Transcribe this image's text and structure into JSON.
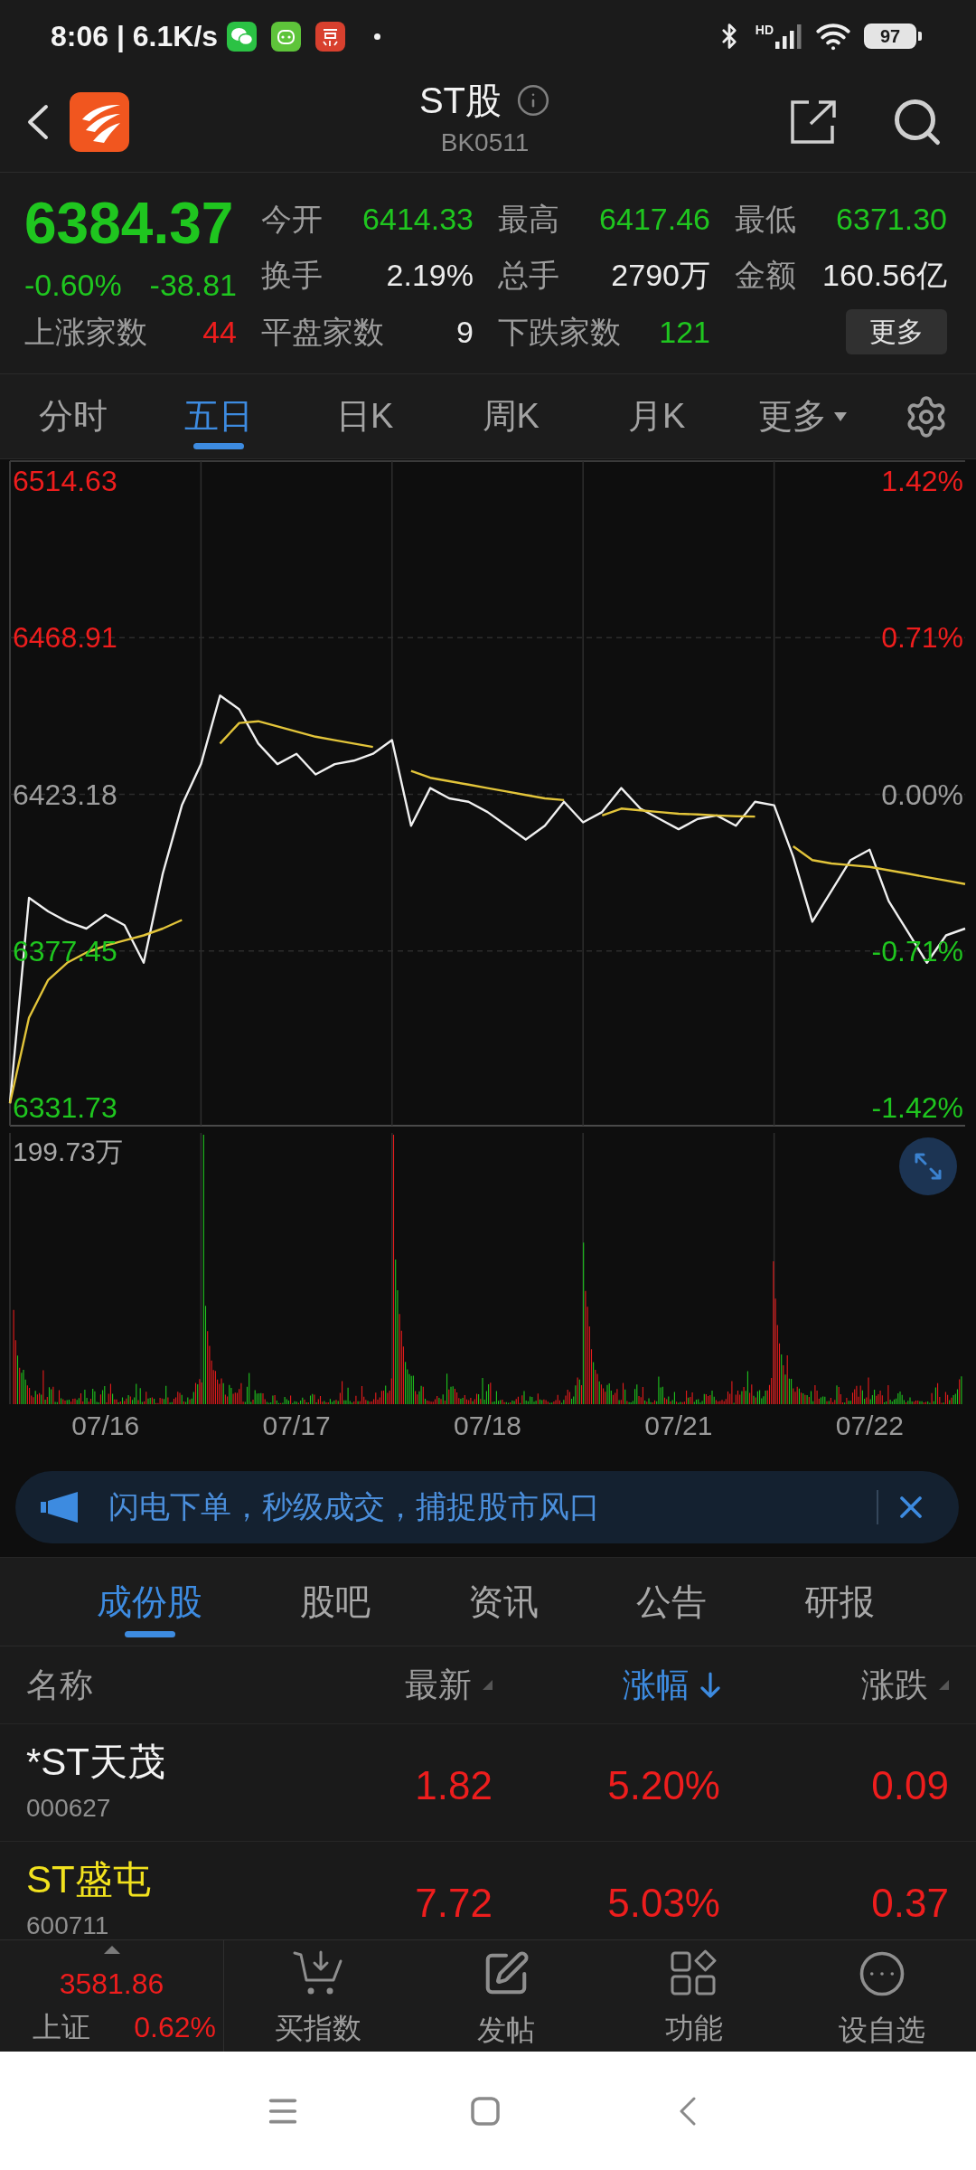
{
  "status_bar": {
    "text": "8:06 | 6.1K/s",
    "network": "HD",
    "battery": "97"
  },
  "header": {
    "title": "ST股",
    "code": "BK0511"
  },
  "quote": {
    "color": "#1fc61f",
    "price": "6384.37",
    "change_pct": "-0.60%",
    "change": "-38.81",
    "stats": [
      {
        "label": "今开",
        "value": "6414.33",
        "color": "#1fc61f"
      },
      {
        "label": "最高",
        "value": "6417.46",
        "color": "#1fc61f"
      },
      {
        "label": "最低",
        "value": "6371.30",
        "color": "#1fc61f"
      },
      {
        "label": "换手",
        "value": "2.19%",
        "color": "#ececec"
      },
      {
        "label": "总手",
        "value": "2790万",
        "color": "#ececec"
      },
      {
        "label": "金额",
        "value": "160.56亿",
        "color": "#ececec"
      }
    ],
    "counts": [
      {
        "label": "上涨家数",
        "value": "44",
        "color": "#ee1d1d"
      },
      {
        "label": "平盘家数",
        "value": "9",
        "color": "#ececec"
      },
      {
        "label": "下跌家数",
        "value": "121",
        "color": "#1fc61f"
      }
    ],
    "more_button": "更多"
  },
  "chart_tabs": [
    {
      "label": "分时",
      "selected": false,
      "menu": false
    },
    {
      "label": "五日",
      "selected": true,
      "menu": false
    },
    {
      "label": "日K",
      "selected": false,
      "menu": false
    },
    {
      "label": "周K",
      "selected": false,
      "menu": false
    },
    {
      "label": "月K",
      "selected": false,
      "menu": false
    },
    {
      "label": "更多",
      "selected": false,
      "menu": true
    }
  ],
  "chart": {
    "percent_labels": [
      "1.42%",
      "0.71%",
      "0.00%",
      "-0.71%",
      "-1.42%"
    ],
    "chart_data": {
      "type": "line",
      "categories": [
        null,
        null,
        null,
        null,
        null,
        null,
        null,
        null,
        null,
        null,
        null,
        null,
        null,
        null,
        null,
        null,
        null,
        null,
        null,
        null,
        null,
        null,
        null,
        null,
        null,
        null,
        null,
        null,
        null,
        null,
        null,
        null,
        null,
        null,
        null,
        null,
        null,
        null,
        null,
        null,
        null,
        null,
        null,
        null,
        null,
        null,
        null,
        null,
        null,
        null,
        null
      ],
      "series": [
        {
          "color": "#f0f0f0",
          "values": [
            6333,
            6393,
            6389,
            6386,
            6384,
            6388,
            6385,
            6374,
            6400,
            6420,
            6432,
            6452,
            6448,
            6438,
            6432,
            6435,
            6429,
            6432,
            6433,
            6435,
            6439,
            6414,
            6425,
            6422,
            6421,
            6418,
            6414,
            6410,
            6414,
            6421,
            6415,
            6418,
            6425,
            6419,
            6416,
            6413,
            6416,
            6417,
            6414,
            6421,
            6420,
            6405,
            6386,
            6395,
            6404,
            6407,
            6392,
            6383,
            6374,
            6382,
            6384
          ]
        },
        {
          "color": "#e2c43a",
          "values": [
            6333,
            6358,
            6369,
            6374,
            6377,
            6379,
            6380.5,
            6382,
            6384,
            6386.5,
            null,
            6438,
            6444,
            6444.5,
            6443,
            6441.5,
            6440,
            6439,
            6438,
            6437,
            null,
            6430,
            6428,
            6427,
            6426,
            6425,
            6424,
            6423,
            6422,
            6421.5,
            null,
            6417,
            6419,
            6418.5,
            6418,
            6417.5,
            6417.3,
            6417,
            6416.8,
            6416.7,
            null,
            6408,
            6404,
            6403,
            6402.5,
            6402,
            6401,
            6400,
            6399,
            6398,
            6397
          ]
        }
      ],
      "ylim": [
        6326.45,
        6520.44
      ],
      "yticks": [
        {
          "value": 6514.63,
          "label": "6514.63"
        },
        {
          "value": 6468.91,
          "label": "6468.91"
        },
        {
          "value": 6423.18,
          "label": "6423.18"
        },
        {
          "value": 6377.45,
          "label": "6377.45"
        },
        {
          "value": 6331.73,
          "label": "6331.73"
        }
      ],
      "grid": true
    },
    "volume_label": "199.73万",
    "dates": [
      "07/16",
      "07/17",
      "07/18",
      "07/21",
      "07/22"
    ]
  },
  "banner": {
    "text": "闪电下单，秒级成交，捕捉股市风口"
  },
  "section_tabs": [
    {
      "label": "成份股",
      "selected": true
    },
    {
      "label": "股吧",
      "selected": false
    },
    {
      "label": "资讯",
      "selected": false
    },
    {
      "label": "公告",
      "selected": false
    },
    {
      "label": "研报",
      "selected": false
    }
  ],
  "table": {
    "columns": [
      {
        "label": "名称",
        "sortable": false,
        "selected": false
      },
      {
        "label": "最新",
        "sortable": true,
        "selected": false
      },
      {
        "label": "涨幅",
        "sortable": true,
        "selected": true
      },
      {
        "label": "涨跌",
        "sortable": true,
        "selected": false
      }
    ],
    "rows": [
      {
        "name": "*ST天茂",
        "code": "000627",
        "price": "1.82",
        "change_pct": "5.20%",
        "change": "0.09",
        "color": "#ee1d1d",
        "name_highlight": false
      },
      {
        "name": "ST盛屯",
        "code": "600711",
        "price": "7.72",
        "change_pct": "5.03%",
        "change": "0.37",
        "color": "#ee1d1d",
        "name_highlight": true
      }
    ]
  },
  "bottom_bar": {
    "index": {
      "value": "3581.86",
      "name": "上证",
      "change": "0.62%",
      "color": "#ee1d1d"
    },
    "actions": [
      {
        "label": "买指数",
        "kind": "cart"
      },
      {
        "label": "发帖",
        "kind": "edit"
      },
      {
        "label": "功能",
        "kind": "grid"
      },
      {
        "label": "设自选",
        "kind": "more"
      }
    ]
  }
}
